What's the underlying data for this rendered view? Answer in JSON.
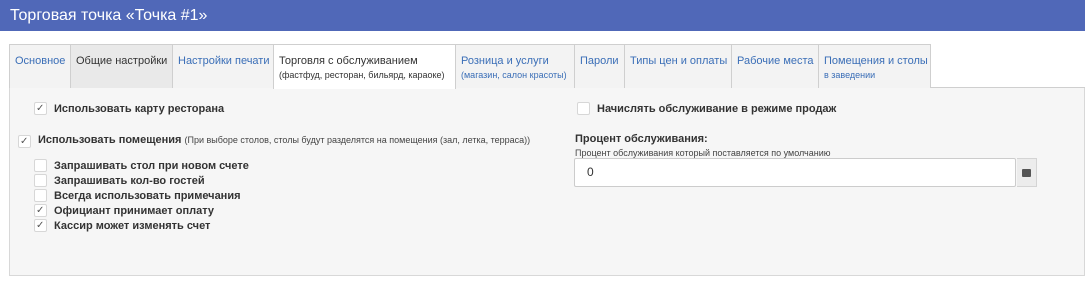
{
  "window": {
    "title": "Торговая точка «Точка #1»"
  },
  "tabs": [
    {
      "label": "Основное",
      "sub": ""
    },
    {
      "label": "Общие настройки",
      "sub": ""
    },
    {
      "label": "Настройки печати",
      "sub": ""
    },
    {
      "label": "Торговля с обслуживанием",
      "sub": "(фастфуд, ресторан, бильярд, караоке)"
    },
    {
      "label": "Розница и услуги",
      "sub": "(магазин, салон красоты)"
    },
    {
      "label": "Пароли",
      "sub": ""
    },
    {
      "label": "Типы цен и оплаты",
      "sub": ""
    },
    {
      "label": "Рабочие места",
      "sub": ""
    },
    {
      "label": "Помещения и столы",
      "sub": "в заведении"
    }
  ],
  "left": {
    "use_map": {
      "label": "Использовать карту ресторана",
      "checked": true
    },
    "use_rooms": {
      "label": "Использовать помещения",
      "note": "(При выборе столов, столы будут разделятся на помещения (зал, летка, терраса))",
      "checked": true
    },
    "ask_table": {
      "label": "Запрашивать стол при новом счете",
      "checked": false
    },
    "ask_guests": {
      "label": "Запрашивать кол-во гостей",
      "checked": false
    },
    "always_notes": {
      "label": "Всегда использовать примечания",
      "checked": false
    },
    "waiter_payment": {
      "label": "Официант принимает оплату",
      "checked": true
    },
    "cashier_edit": {
      "label": "Кассир может изменять счет",
      "checked": true
    }
  },
  "right": {
    "charge_service": {
      "label": "Начислять обслуживание в режиме продаж",
      "checked": false
    },
    "service_percent": {
      "label": "Процент обслуживания:",
      "hint": "Процент обслуживания который поставляется по умолчанию",
      "value": "0"
    }
  }
}
